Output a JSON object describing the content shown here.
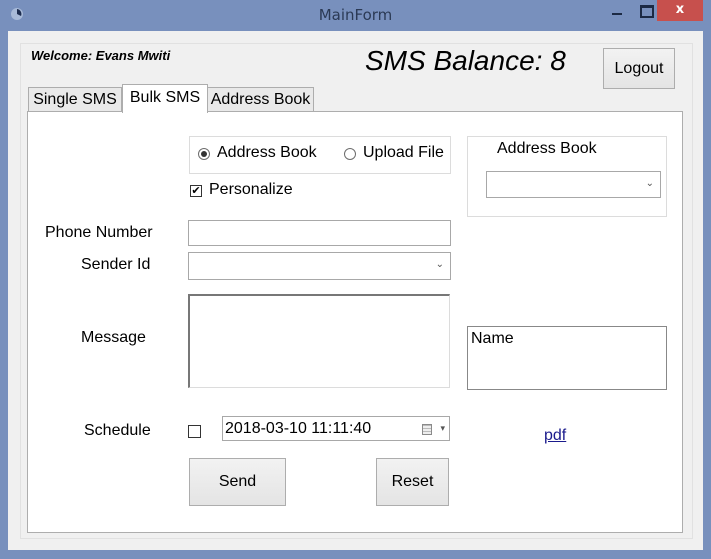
{
  "window": {
    "title": "MainForm",
    "close_glyph": "x"
  },
  "header": {
    "welcome": "Welcome: Evans Mwiti",
    "balance": "SMS Balance: 8",
    "logout_label": "Logout"
  },
  "tabs": [
    {
      "label": "Single SMS",
      "active": false
    },
    {
      "label": "Bulk SMS",
      "active": true
    },
    {
      "label": "Address Book",
      "active": false
    }
  ],
  "bulk": {
    "source_options": [
      {
        "label": "Address Book",
        "checked": true
      },
      {
        "label": "Upload File",
        "checked": false
      }
    ],
    "personalize": {
      "label": "Personalize",
      "checked": true
    },
    "address_book_group": {
      "title": "Address Book",
      "selected": ""
    },
    "phone_label": "Phone Number",
    "phone_value": "",
    "sender_label": "Sender Id",
    "sender_selected": "",
    "message_label": "Message",
    "message_value": "",
    "name_box_text": "Name",
    "schedule_label": "Schedule",
    "schedule_checked": false,
    "schedule_datetime": "2018-03-10 11:11:40",
    "pdf_link": "pdf",
    "send_label": "Send",
    "reset_label": "Reset"
  },
  "icons": {
    "checkmark": "✔",
    "chevron": "⌄",
    "dropdown_arrow": "▾"
  }
}
